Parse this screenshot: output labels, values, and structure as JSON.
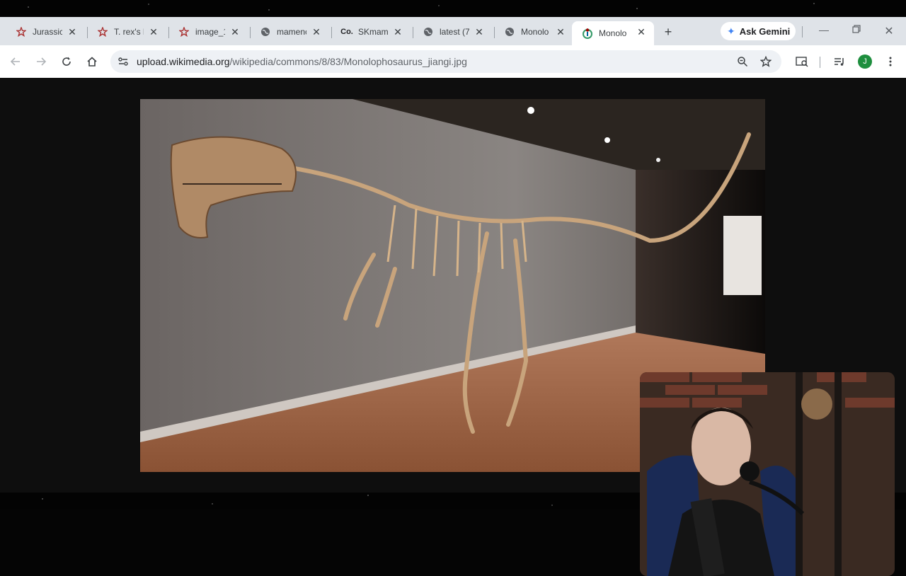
{
  "tabs": [
    {
      "title": "Jurassic",
      "icon": "wiki-star-icon"
    },
    {
      "title": "T. rex's l",
      "icon": "wiki-star-icon"
    },
    {
      "title": "image_1",
      "icon": "wiki-star-icon"
    },
    {
      "title": "mamenc",
      "icon": "globe-icon"
    },
    {
      "title": "SKmam",
      "icon": "co-icon",
      "icon_text": "Co."
    },
    {
      "title": "latest (7",
      "icon": "globe-icon"
    },
    {
      "title": "Monolo",
      "icon": "globe-icon"
    },
    {
      "title": "Monolo",
      "icon": "wikimedia-icon",
      "active": true
    }
  ],
  "gemini_label": "Ask Gemini",
  "url": {
    "host": "upload.wikimedia.org",
    "path": "/wikipedia/commons/8/83/Monolophosaurus_jiangi.jpg"
  },
  "profile_initial": "J",
  "colors": {
    "tabstrip": "#dfe3e8",
    "omnibox": "#eef1f5",
    "profile": "#1e8e3e"
  }
}
